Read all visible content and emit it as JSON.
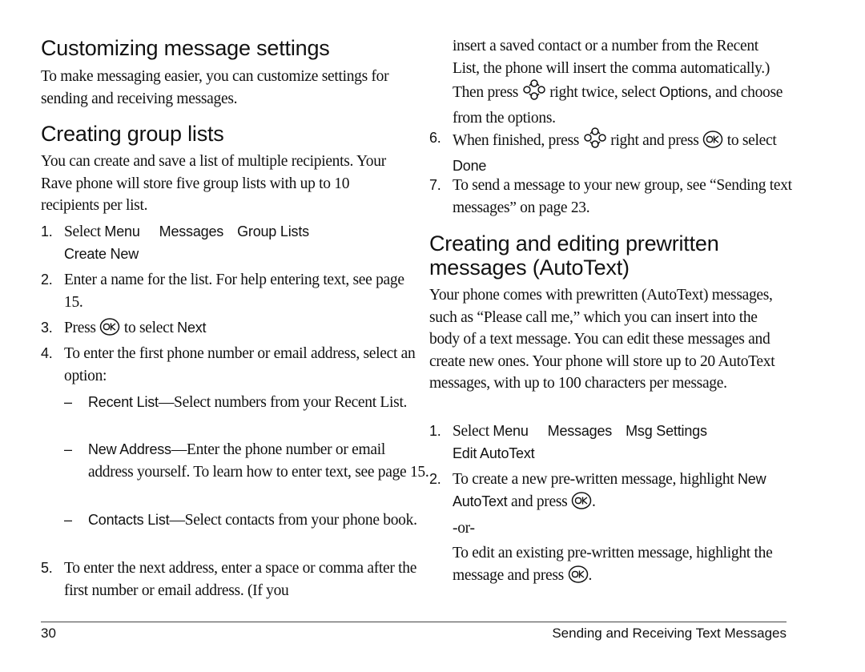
{
  "left": {
    "section1": {
      "heading": "Customizing message settings",
      "intro": "To make messaging easier, you can customize settings for sending and receiving messages."
    },
    "section2": {
      "heading": "Creating group lists",
      "intro": "You can create and save a list of multiple recipients. Your Rave phone will store five group lists with up to 10 recipients per list.",
      "steps": [
        {
          "num": "1.",
          "lead": "Select ",
          "path": [
            "Menu",
            "Messages",
            "Group Lists",
            "Create New"
          ]
        },
        {
          "num": "2.",
          "text": "Enter a name for the list. For help entering text, see page 15."
        },
        {
          "num": "3.",
          "before": "Press",
          "after": "to select",
          "term": "Next"
        },
        {
          "num": "4.",
          "text": "To enter the first phone number or email address, select an option:"
        }
      ],
      "options": [
        {
          "dash": "–",
          "term": "Recent List",
          "text": "—Select numbers from your Recent List."
        },
        {
          "dash": "–",
          "term": "New Address",
          "text": "—Enter the phone number or email address yourself. To learn how to enter text, see page 15."
        },
        {
          "dash": "–",
          "term": "Contacts List",
          "text": "—Select contacts from your phone book."
        }
      ],
      "step5": {
        "num": "5.",
        "text": "To enter the next address, enter a space or comma after the first number or email address. (If you"
      }
    }
  },
  "right": {
    "step5_cont": {
      "text1": "insert a saved contact or a number from the Recent List, the phone will insert the comma automatically.) Then press",
      "text2": "right twice, select",
      "term": "Options",
      "text3": ", and choose from the options."
    },
    "step6": {
      "num": "6.",
      "before": "When finished, press",
      "mid": "right and press",
      "after": "to select",
      "term": "Done"
    },
    "step7": {
      "num": "7.",
      "text": "To send a message to your new group, see “Sending text messages” on page 23."
    },
    "section3": {
      "heading": "Creating and editing prewritten messages (AutoText)",
      "intro": "Your phone comes with prewritten (AutoText) messages, such as “Please call me,” which you can insert into the body of a text message. You can edit these messages and create new ones. Your phone will store up to 20 AutoText messages, with up to 100 characters per message.",
      "steps": [
        {
          "num": "1.",
          "lead": "Select ",
          "path": [
            "Menu",
            "Messages",
            "Msg Settings",
            "Edit AutoText"
          ]
        },
        {
          "num": "2.",
          "before": "To create a new pre-written message, highlight",
          "term": "New AutoText",
          "after": "and press",
          "end": "."
        }
      ],
      "or": "-or-",
      "edit_text": "To edit an existing pre-written message, highlight the message and press",
      "edit_end": "."
    }
  },
  "icons": {
    "ok_key": "ok-key-icon",
    "nav_key": "navigation-key-icon"
  },
  "footer": {
    "page_number": "30",
    "chapter_title": "Sending and Receiving Text Messages"
  }
}
